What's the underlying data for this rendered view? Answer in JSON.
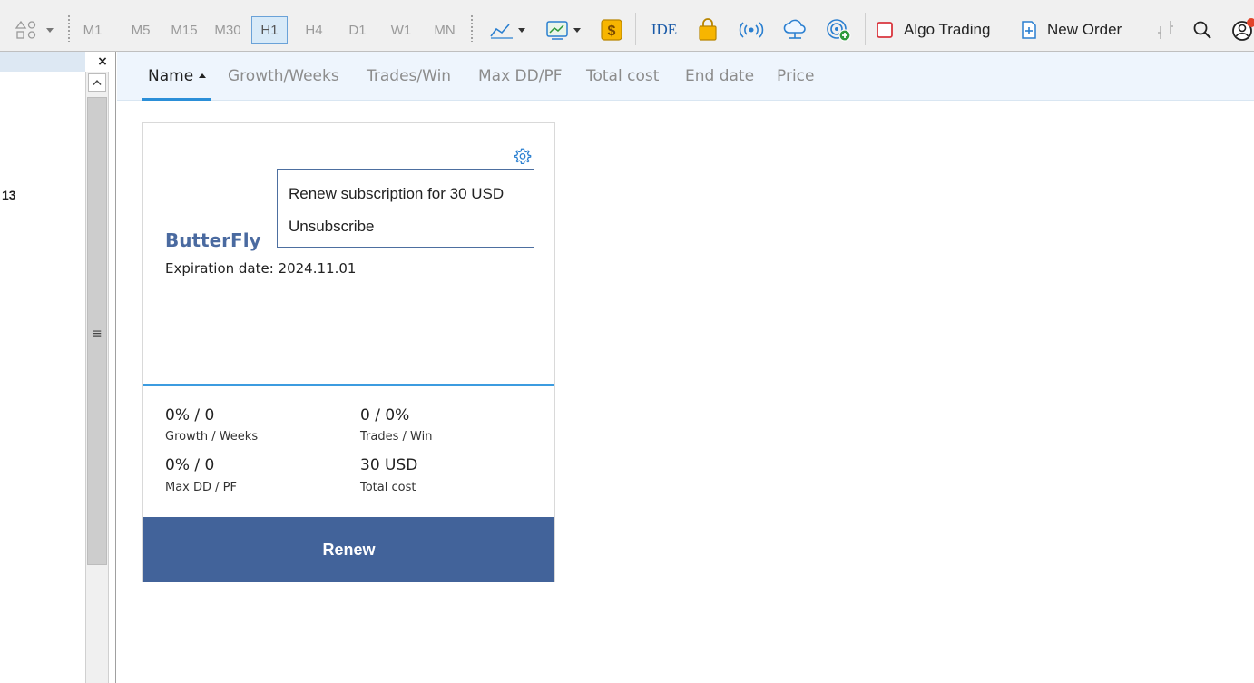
{
  "toolbar": {
    "timeframes": [
      "M1",
      "M5",
      "M15",
      "M30",
      "H1",
      "H4",
      "D1",
      "W1",
      "MN"
    ],
    "active_timeframe": "H1",
    "ide_label": "IDE",
    "algo_trading_label": "Algo Trading",
    "new_order_label": "New Order",
    "icons": [
      "objects-icon",
      "indicators-icon",
      "templates-icon",
      "dollar-signal-icon",
      "market-bag-icon",
      "signals-broadcast-icon",
      "vps-cloud-icon",
      "radar-plus-icon",
      "algo-trading-icon",
      "new-order-icon",
      "crosshair-icon",
      "search-icon",
      "profile-icon"
    ]
  },
  "left_panel": {
    "close_label": "×",
    "scroll_grip": "≡",
    "partial_text": "13"
  },
  "tabs": [
    {
      "label": "Name",
      "active": true
    },
    {
      "label": "Growth/Weeks"
    },
    {
      "label": "Trades/Win"
    },
    {
      "label": "Max DD/PF"
    },
    {
      "label": "Total cost"
    },
    {
      "label": "End date"
    },
    {
      "label": "Price"
    }
  ],
  "card": {
    "name": "ButterFly",
    "expiration": "Expiration date: 2024.11.01",
    "stats": {
      "growth_value": "0% / 0",
      "growth_label": "Growth / Weeks",
      "trades_value": "0 / 0%",
      "trades_label": "Trades / Win",
      "maxdd_value": "0% / 0",
      "maxdd_label": "Max DD / PF",
      "cost_value": "30 USD",
      "cost_label": "Total cost"
    },
    "renew_label": "Renew"
  },
  "menu": {
    "items": [
      "Renew subscription for 30 USD",
      "Unsubscribe"
    ]
  },
  "colors": {
    "accent": "#2b8fd8",
    "button": "#42639a",
    "name": "#4a6aa0",
    "algo_square": "#d9363e"
  }
}
